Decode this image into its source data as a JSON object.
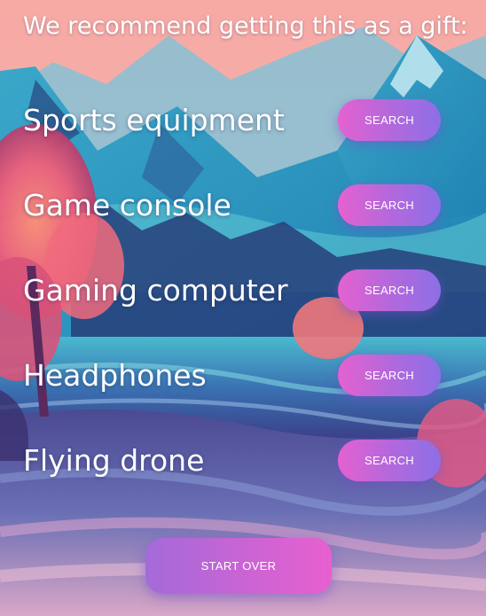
{
  "heading": "We recommend getting this as a gift:",
  "items": [
    {
      "label": "Sports equipment",
      "button": "SEARCH"
    },
    {
      "label": "Game console",
      "button": "SEARCH"
    },
    {
      "label": "Gaming computer",
      "button": "SEARCH"
    },
    {
      "label": "Headphones",
      "button": "SEARCH"
    },
    {
      "label": "Flying drone",
      "button": "SEARCH"
    }
  ],
  "start_over": "START OVER",
  "colors": {
    "button_gradient_start": "#e561d0",
    "button_gradient_end": "#8d6fe6",
    "text": "#ffffff"
  }
}
